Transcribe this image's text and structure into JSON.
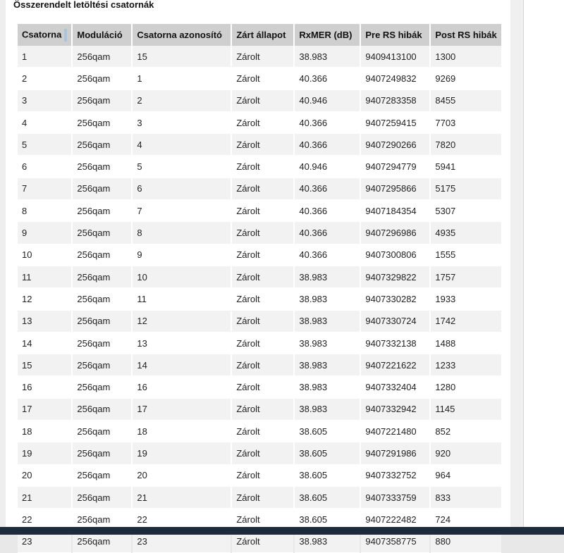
{
  "section_title": "Összerendelt letöltési csatornák",
  "table": {
    "headers": [
      "Csatorna",
      "Moduláció",
      "Csatorna azonosító",
      "Zárt állapot",
      "RxMER (dB)",
      "Pre RS hibák",
      "Post RS hibák"
    ],
    "rows": [
      [
        "1",
        "256qam",
        "15",
        "Zárolt",
        "38.983",
        "9409413100",
        "1300"
      ],
      [
        "2",
        "256qam",
        "1",
        "Zárolt",
        "40.366",
        "9407249832",
        "9269"
      ],
      [
        "3",
        "256qam",
        "2",
        "Zárolt",
        "40.946",
        "9407283358",
        "8455"
      ],
      [
        "4",
        "256qam",
        "3",
        "Zárolt",
        "40.366",
        "9407259415",
        "7703"
      ],
      [
        "5",
        "256qam",
        "4",
        "Zárolt",
        "40.366",
        "9407290266",
        "7820"
      ],
      [
        "6",
        "256qam",
        "5",
        "Zárolt",
        "40.946",
        "9407294779",
        "5941"
      ],
      [
        "7",
        "256qam",
        "6",
        "Zárolt",
        "40.366",
        "9407295866",
        "5175"
      ],
      [
        "8",
        "256qam",
        "7",
        "Zárolt",
        "40.366",
        "9407184354",
        "5307"
      ],
      [
        "9",
        "256qam",
        "8",
        "Zárolt",
        "40.366",
        "9407296986",
        "4935"
      ],
      [
        "10",
        "256qam",
        "9",
        "Zárolt",
        "40.366",
        "9407300806",
        "1555"
      ],
      [
        "11",
        "256qam",
        "10",
        "Zárolt",
        "38.983",
        "9407329822",
        "1757"
      ],
      [
        "12",
        "256qam",
        "11",
        "Zárolt",
        "38.983",
        "9407330282",
        "1933"
      ],
      [
        "13",
        "256qam",
        "12",
        "Zárolt",
        "38.983",
        "9407330724",
        "1742"
      ],
      [
        "14",
        "256qam",
        "13",
        "Zárolt",
        "38.983",
        "9407332138",
        "1488"
      ],
      [
        "15",
        "256qam",
        "14",
        "Zárolt",
        "38.983",
        "9407221622",
        "1233"
      ],
      [
        "16",
        "256qam",
        "16",
        "Zárolt",
        "38.983",
        "9407332404",
        "1280"
      ],
      [
        "17",
        "256qam",
        "17",
        "Zárolt",
        "38.983",
        "9407332942",
        "1145"
      ],
      [
        "18",
        "256qam",
        "18",
        "Zárolt",
        "38.605",
        "9407221480",
        "852"
      ],
      [
        "19",
        "256qam",
        "19",
        "Zárolt",
        "38.605",
        "9407291986",
        "920"
      ],
      [
        "20",
        "256qam",
        "20",
        "Zárolt",
        "38.605",
        "9407332752",
        "964"
      ],
      [
        "21",
        "256qam",
        "21",
        "Zárolt",
        "38.605",
        "9407333759",
        "833"
      ],
      [
        "22",
        "256qam",
        "22",
        "Zárolt",
        "38.605",
        "9407222482",
        "724"
      ],
      [
        "23",
        "256qam",
        "23",
        "Zárolt",
        "38.983",
        "9407358775",
        "880"
      ]
    ]
  },
  "colors": {
    "header_bg": "#cfcfcf",
    "row_alt_bg": "#f2f2f2",
    "taskbar": "#1e2b3c"
  }
}
